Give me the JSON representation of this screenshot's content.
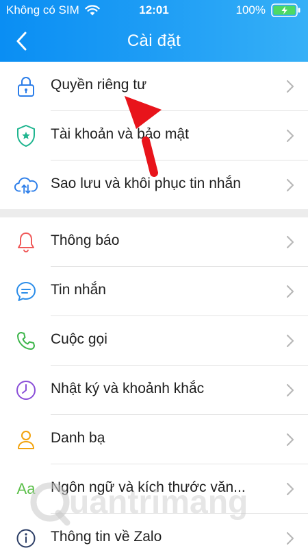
{
  "status": {
    "carrier": "Không có SIM",
    "time": "12:01",
    "battery": "100%"
  },
  "nav": {
    "title": "Cài đặt"
  },
  "groups": [
    {
      "items": [
        {
          "label": "Quyền riêng tư",
          "icon": "lock-icon"
        },
        {
          "label": "Tài khoản và bảo mật",
          "icon": "shield-icon"
        },
        {
          "label": "Sao lưu và khôi phục tin nhắn",
          "icon": "cloud-sync-icon"
        }
      ]
    },
    {
      "items": [
        {
          "label": "Thông báo",
          "icon": "bell-icon"
        },
        {
          "label": "Tin nhắn",
          "icon": "chat-bubble-icon"
        },
        {
          "label": "Cuộc gọi",
          "icon": "phone-icon"
        },
        {
          "label": "Nhật ký và khoảnh khắc",
          "icon": "clock-icon"
        },
        {
          "label": "Danh bạ",
          "icon": "person-icon"
        },
        {
          "label": "Ngôn ngữ và kích thước văn...",
          "icon": "text-size-icon",
          "icon_text": "Aa"
        },
        {
          "label": "Thông tin về Zalo",
          "icon": "info-icon"
        }
      ]
    }
  ],
  "colors": {
    "header_start": "#0a8ef3",
    "header_end": "#36b0f7",
    "lock": "#2b7de9",
    "shield": "#1fb58f",
    "cloud": "#2b7de9",
    "bell": "#f05a5a",
    "chat": "#2b8de9",
    "phone": "#3cb54a",
    "clock": "#8a4fd8",
    "person": "#f2a20c",
    "text_size": "#5cbf4a",
    "info": "#2c3e66",
    "arrow": "#e8141b"
  },
  "watermark": {
    "text": "uantrimang"
  }
}
